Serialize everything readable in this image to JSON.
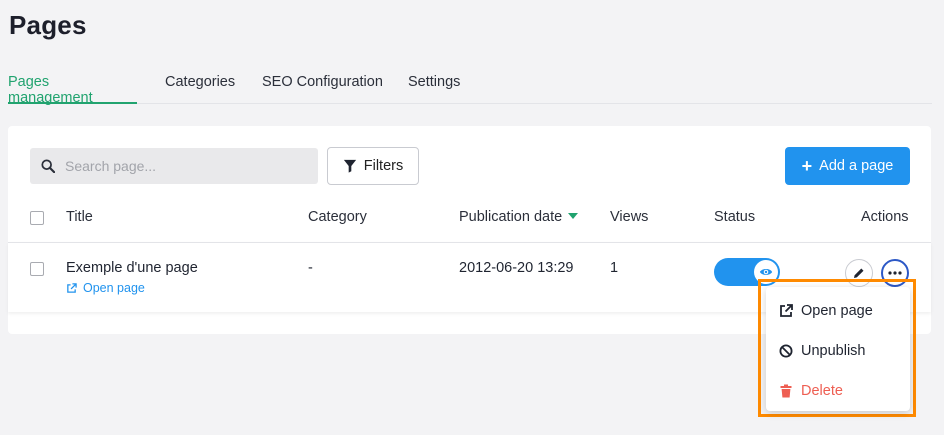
{
  "page": {
    "title": "Pages"
  },
  "tabs": [
    {
      "label": "Pages management",
      "active": true
    },
    {
      "label": "Categories",
      "active": false
    },
    {
      "label": "SEO Configuration",
      "active": false
    },
    {
      "label": "Settings",
      "active": false
    }
  ],
  "toolbar": {
    "search_placeholder": "Search page...",
    "filters_label": "Filters",
    "add_label": "Add a page"
  },
  "table": {
    "headers": {
      "title": "Title",
      "category": "Category",
      "date": "Publication date",
      "views": "Views",
      "status": "Status",
      "actions": "Actions"
    },
    "sort": {
      "column": "Publication date",
      "direction": "desc"
    },
    "rows": [
      {
        "title": "Exemple d'une page",
        "link": "Open page",
        "category": "-",
        "date": "2012-06-20 13:29",
        "views": "1",
        "published": true
      }
    ]
  },
  "dropdown": {
    "items": [
      {
        "label": "Open page",
        "icon": "external-link-icon"
      },
      {
        "label": "Unpublish",
        "icon": "ban-icon"
      },
      {
        "label": "Delete",
        "icon": "trash-icon"
      }
    ]
  },
  "colors": {
    "accent": "#21a36f",
    "primary": "#2193ee",
    "danger": "#ee5e52",
    "highlight": "#ff8a00"
  }
}
